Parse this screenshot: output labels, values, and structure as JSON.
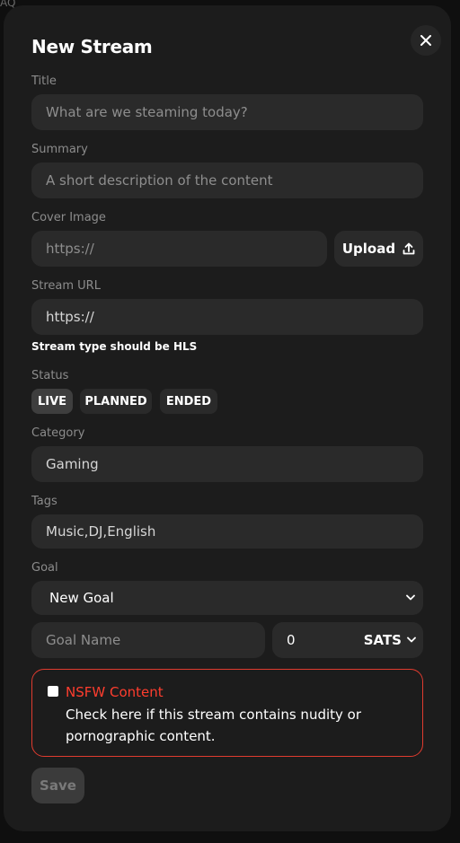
{
  "background": {
    "text_top": "AQ"
  },
  "modal": {
    "title": "New Stream",
    "close_icon": "close-icon",
    "title_field": {
      "label": "Title",
      "placeholder": "What are we steaming today?"
    },
    "summary_field": {
      "label": "Summary",
      "placeholder": "A short description of the content"
    },
    "cover_image": {
      "label": "Cover Image",
      "placeholder": "https://",
      "upload_label": "Upload",
      "upload_icon": "upload-icon"
    },
    "stream_url": {
      "label": "Stream URL",
      "placeholder": "https://",
      "hint": "Stream type should be HLS"
    },
    "status": {
      "label": "Status",
      "options": [
        "LIVE",
        "PLANNED",
        "ENDED"
      ],
      "selected": "LIVE"
    },
    "category": {
      "label": "Category",
      "value": "Gaming"
    },
    "tags": {
      "label": "Tags",
      "value": "Music,DJ,English"
    },
    "goal": {
      "label": "Goal",
      "selected": "New Goal",
      "name_placeholder": "Goal Name",
      "amount": "0",
      "unit": "SATS"
    },
    "nsfw": {
      "title": "NSFW Content",
      "description": "Check here if this stream contains nudity or pornographic content.",
      "checked": false,
      "color": "#e03b2f"
    },
    "save_label": "Save"
  }
}
